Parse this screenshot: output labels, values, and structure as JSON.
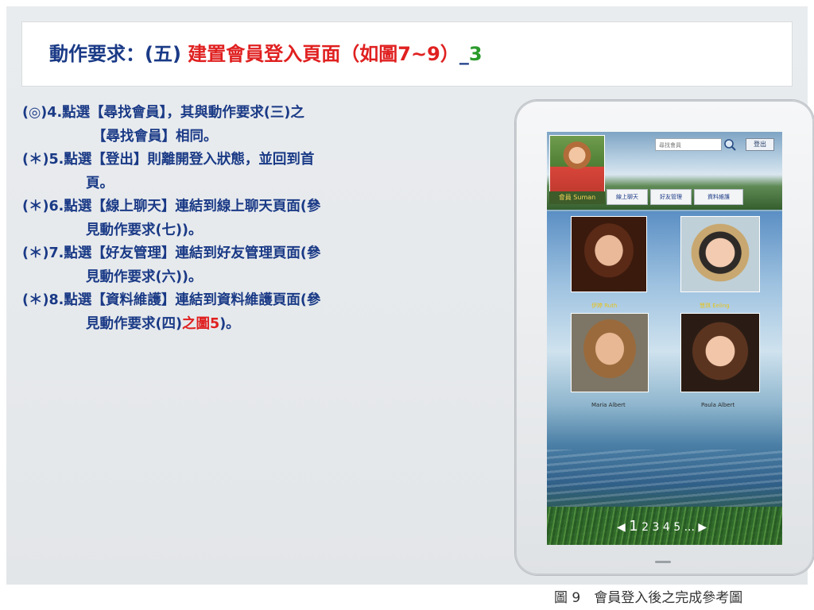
{
  "title": {
    "prefix": "動作要求：(五) ",
    "highlight": "建置會員登入頁面（如圖7~9）",
    "suffix_underscore": "_",
    "suffix_number": "3"
  },
  "items": [
    {
      "l1": "(◎)4.點選【尋找會員】，其與動作要求(三)之",
      "l2": "【尋找會員】相同。"
    },
    {
      "l1": "(＊)5.點選【登出】則離開登入狀態，並回到首",
      "l2": "頁。"
    },
    {
      "l1": "(＊)6.點選【線上聊天】連結到線上聊天頁面(參",
      "l2": "見動作要求(七))。"
    },
    {
      "l1": "(＊)7.點選【好友管理】連結到好友管理頁面(參",
      "l2": "見動作要求(六))。"
    },
    {
      "l1": "(＊)8.點選【資料維護】連結到資料維護頁面(參",
      "l2a": "見動作要求(四)",
      "l2red": "之圖5",
      "l2b": ")。"
    }
  ],
  "mockup": {
    "member_name": "會員 Suman",
    "search_placeholder": "尋找會員",
    "logout_label": "登出",
    "nav": [
      "線上聊天",
      "好友管理",
      "資料維護"
    ],
    "friends": [
      "伊婷 Ruth",
      "慧琪 Eeling",
      "Maria Albert",
      "Paula Albert"
    ],
    "pager": {
      "prev": "◀",
      "current": "1",
      "pages": " 2 3 4 5 ...",
      "next": "▶"
    }
  },
  "caption": "圖 9　會員登入後之完成參考圖",
  "colors": {
    "title_blue": "#1a3a86",
    "highlight_red": "#e02020",
    "suffix_green": "#2a9a2a"
  }
}
